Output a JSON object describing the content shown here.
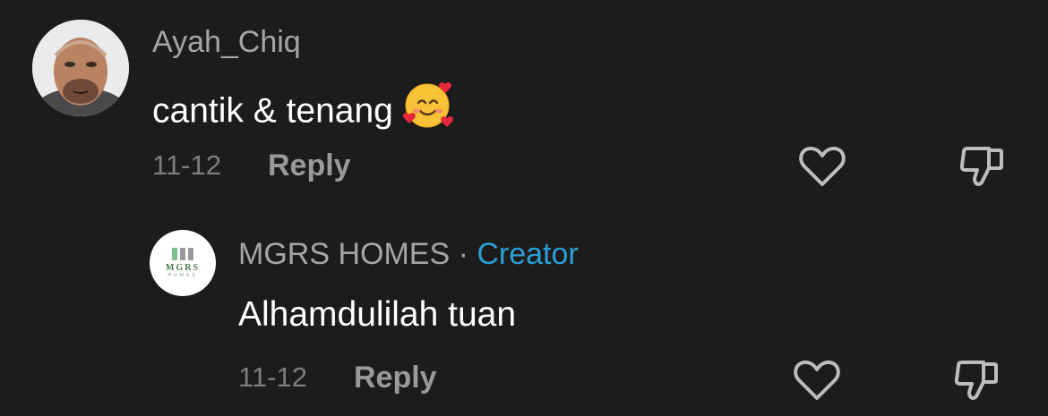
{
  "comments": [
    {
      "username": "Ayah_Chiq",
      "text": "cantik & tenang",
      "emoji": "smiling-face-with-hearts",
      "date": "11-12",
      "reply_label": "Reply",
      "like_icon": "heart-outline-icon",
      "dislike_icon": "thumbs-down-outline-icon"
    },
    {
      "username": "MGRS HOMES",
      "separator": "·",
      "badge": "Creator",
      "avatar_logo_text": "MGRS",
      "avatar_logo_sub": "HOMES",
      "text": "Alhamdulilah tuan",
      "date": "11-12",
      "reply_label": "Reply",
      "like_icon": "heart-outline-icon",
      "dislike_icon": "thumbs-down-outline-icon"
    }
  ],
  "colors": {
    "background": "#1c1c1c",
    "username": "#a6a6a6",
    "comment_text": "#ffffff",
    "date": "#7e7e7e",
    "reply": "#9a9a9a",
    "creator_badge": "#2a9fd6",
    "icon": "#bdbdbd",
    "logo_green": "#4a7a4a"
  }
}
